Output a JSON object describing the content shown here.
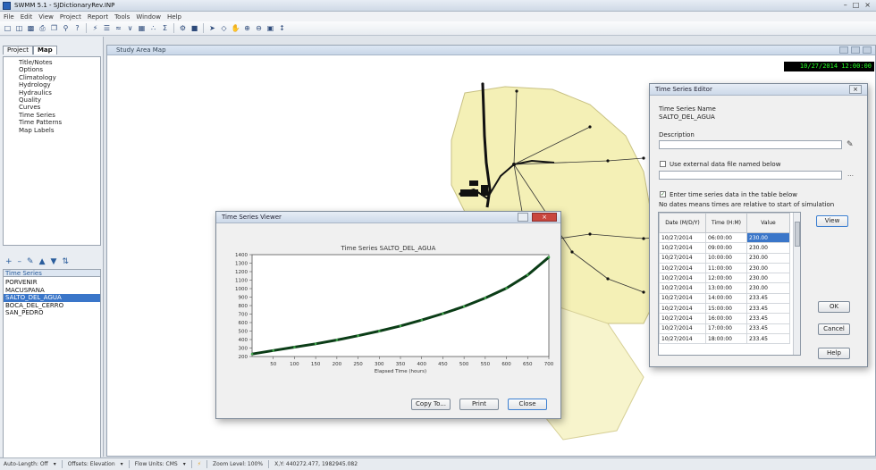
{
  "app": {
    "title": "SWMM 5.1 - SJDictionaryRev.INP",
    "menu": [
      "File",
      "Edit",
      "View",
      "Project",
      "Report",
      "Tools",
      "Window",
      "Help"
    ]
  },
  "left_panel": {
    "tabs": [
      "Project",
      "Map"
    ],
    "tree_items": [
      "Title/Notes",
      "Options",
      "Climatology",
      "Hydrology",
      "Hydraulics",
      "Quality",
      "Curves",
      "Time Series",
      "Time Patterns",
      "Map Labels"
    ],
    "object_header": "Time Series",
    "object_items": [
      "PORVENIR",
      "MACUSPANA",
      "SALTO_DEL_AGUA",
      "BOCA_DEL_CERRO",
      "SAN_PEDRO"
    ],
    "selected_object": "SALTO_DEL_AGUA"
  },
  "map": {
    "title": "Study Area Map",
    "clock": "10/27/2014 12:00:00"
  },
  "editor": {
    "title": "Time Series Editor",
    "name_label": "Time Series Name",
    "name_value": "SALTO_DEL_AGUA",
    "description_label": "Description",
    "use_file_label": "Use external data file named below",
    "enter_table_label": "Enter time series data in the table below",
    "no_dates_note": "No dates means times are relative to start of simulation",
    "columns": [
      "Date (M/D/Y)",
      "Time (H:M)",
      "Value"
    ],
    "rows": [
      [
        "10/27/2014",
        "06:00:00",
        "230.00"
      ],
      [
        "10/27/2014",
        "09:00:00",
        "230.00"
      ],
      [
        "10/27/2014",
        "10:00:00",
        "230.00"
      ],
      [
        "10/27/2014",
        "11:00:00",
        "230.00"
      ],
      [
        "10/27/2014",
        "12:00:00",
        "230.00"
      ],
      [
        "10/27/2014",
        "13:00:00",
        "230.00"
      ],
      [
        "10/27/2014",
        "14:00:00",
        "233.45"
      ],
      [
        "10/27/2014",
        "15:00:00",
        "233.45"
      ],
      [
        "10/27/2014",
        "16:00:00",
        "233.45"
      ],
      [
        "10/27/2014",
        "17:00:00",
        "233.45"
      ],
      [
        "10/27/2014",
        "18:00:00",
        "233.45"
      ]
    ],
    "btn_view": "View",
    "btn_ok": "OK",
    "btn_cancel": "Cancel",
    "btn_help": "Help"
  },
  "viewer": {
    "title": "Time Series Viewer",
    "btn_copy": "Copy To...",
    "btn_print": "Print",
    "btn_close": "Close"
  },
  "chart_data": {
    "type": "line",
    "title": "Time Series SALTO_DEL_AGUA",
    "xlabel": "Elapsed Time (hours)",
    "ylabel": "",
    "xlim": [
      0,
      700
    ],
    "ylim": [
      200,
      1400
    ],
    "xticks": [
      50,
      100,
      150,
      200,
      250,
      300,
      350,
      400,
      450,
      500,
      550,
      600,
      650,
      700
    ],
    "yticks": [
      200,
      300,
      400,
      500,
      600,
      700,
      800,
      900,
      1000,
      1100,
      1200,
      1300,
      1400
    ],
    "series": [
      {
        "color": "#0b3d17",
        "x": [
          0,
          50,
          100,
          150,
          200,
          250,
          300,
          350,
          400,
          450,
          500,
          550,
          600,
          650,
          700
        ],
        "y": [
          230,
          270,
          310,
          350,
          395,
          445,
          500,
          560,
          630,
          705,
          790,
          890,
          1005,
          1160,
          1370
        ]
      }
    ]
  },
  "statusbar": {
    "auto_length": "Auto-Length: Off",
    "offsets": "Offsets: Elevation",
    "flow_units": "Flow Units: CMS",
    "zoom": "Zoom Level: 100%",
    "xy": "X,Y: 440272.477, 1982945.082"
  },
  "colors": {
    "selection": "#3a76c9",
    "subcatchment_fill": "#f4f0b6",
    "clock_text": "#24ff24",
    "series_line": "#0b3d17"
  }
}
